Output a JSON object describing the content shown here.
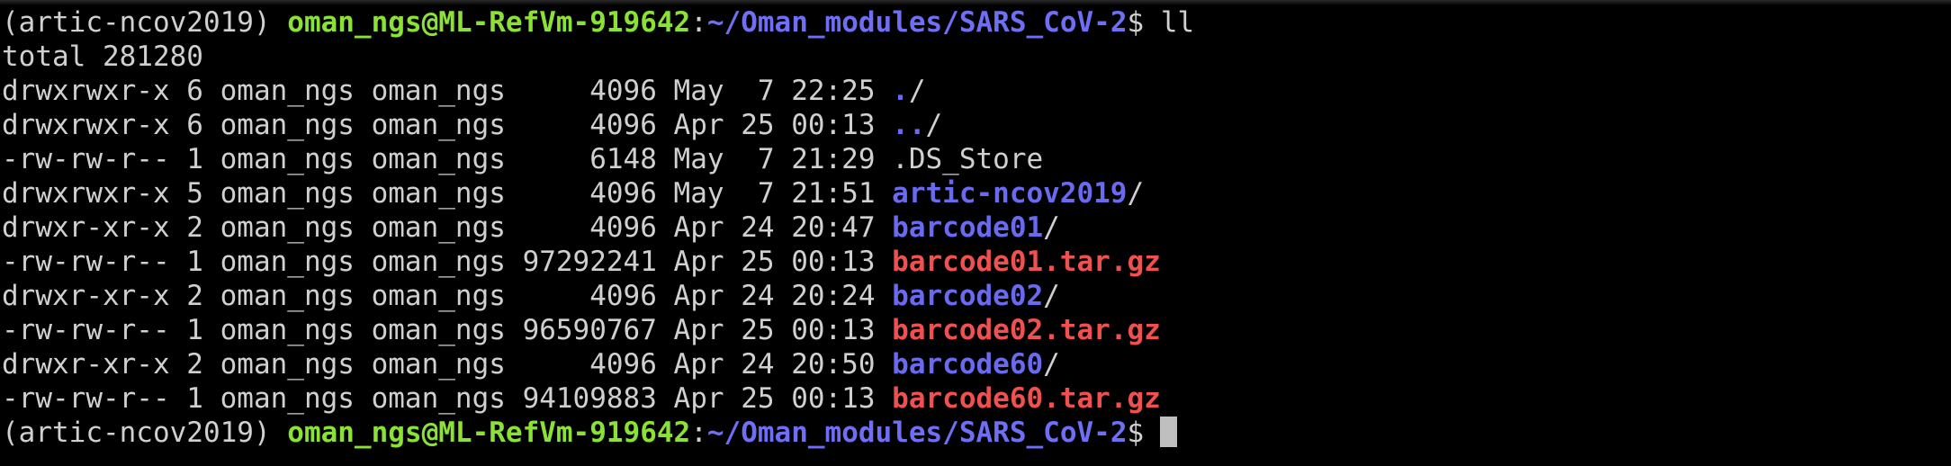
{
  "colors": {
    "background": "#000000",
    "text": "#d0d0d0",
    "prompt_user": "#8ae234",
    "prompt_path": "#6f6ff5",
    "directory": "#6a6af0",
    "archive": "#ef5050",
    "cursor": "#bfbfbf"
  },
  "prompt_top": {
    "env": "(artic-ncov2019) ",
    "user_host": "oman_ngs@ML-RefVm-919642",
    "sep": ":",
    "path": "~/Oman_modules/SARS_CoV-2",
    "symbol": "$ ",
    "command": "ll"
  },
  "total_line": "total 281280",
  "entries": [
    {
      "meta": "drwxrwxr-x 6 oman_ngs oman_ngs     4096 May  7 22:25 ",
      "name": ".",
      "kind": "dir",
      "suffix": "/"
    },
    {
      "meta": "drwxrwxr-x 6 oman_ngs oman_ngs     4096 Apr 25 00:13 ",
      "name": "..",
      "kind": "dir",
      "suffix": "/"
    },
    {
      "meta": "-rw-rw-r-- 1 oman_ngs oman_ngs     6148 May  7 21:29 ",
      "name": ".DS_Store",
      "kind": "file",
      "suffix": ""
    },
    {
      "meta": "drwxrwxr-x 5 oman_ngs oman_ngs     4096 May  7 21:51 ",
      "name": "artic-ncov2019",
      "kind": "dir",
      "suffix": "/"
    },
    {
      "meta": "drwxr-xr-x 2 oman_ngs oman_ngs     4096 Apr 24 20:47 ",
      "name": "barcode01",
      "kind": "dir",
      "suffix": "/"
    },
    {
      "meta": "-rw-rw-r-- 1 oman_ngs oman_ngs 97292241 Apr 25 00:13 ",
      "name": "barcode01.tar.gz",
      "kind": "archive",
      "suffix": ""
    },
    {
      "meta": "drwxr-xr-x 2 oman_ngs oman_ngs     4096 Apr 24 20:24 ",
      "name": "barcode02",
      "kind": "dir",
      "suffix": "/"
    },
    {
      "meta": "-rw-rw-r-- 1 oman_ngs oman_ngs 96590767 Apr 25 00:13 ",
      "name": "barcode02.tar.gz",
      "kind": "archive",
      "suffix": ""
    },
    {
      "meta": "drwxr-xr-x 2 oman_ngs oman_ngs     4096 Apr 24 20:50 ",
      "name": "barcode60",
      "kind": "dir",
      "suffix": "/"
    },
    {
      "meta": "-rw-rw-r-- 1 oman_ngs oman_ngs 94109883 Apr 25 00:13 ",
      "name": "barcode60.tar.gz",
      "kind": "archive",
      "suffix": ""
    }
  ],
  "prompt_bottom": {
    "env": "(artic-ncov2019) ",
    "user_host": "oman_ngs@ML-RefVm-919642",
    "sep": ":",
    "path": "~/Oman_modules/SARS_CoV-2",
    "symbol": "$"
  }
}
